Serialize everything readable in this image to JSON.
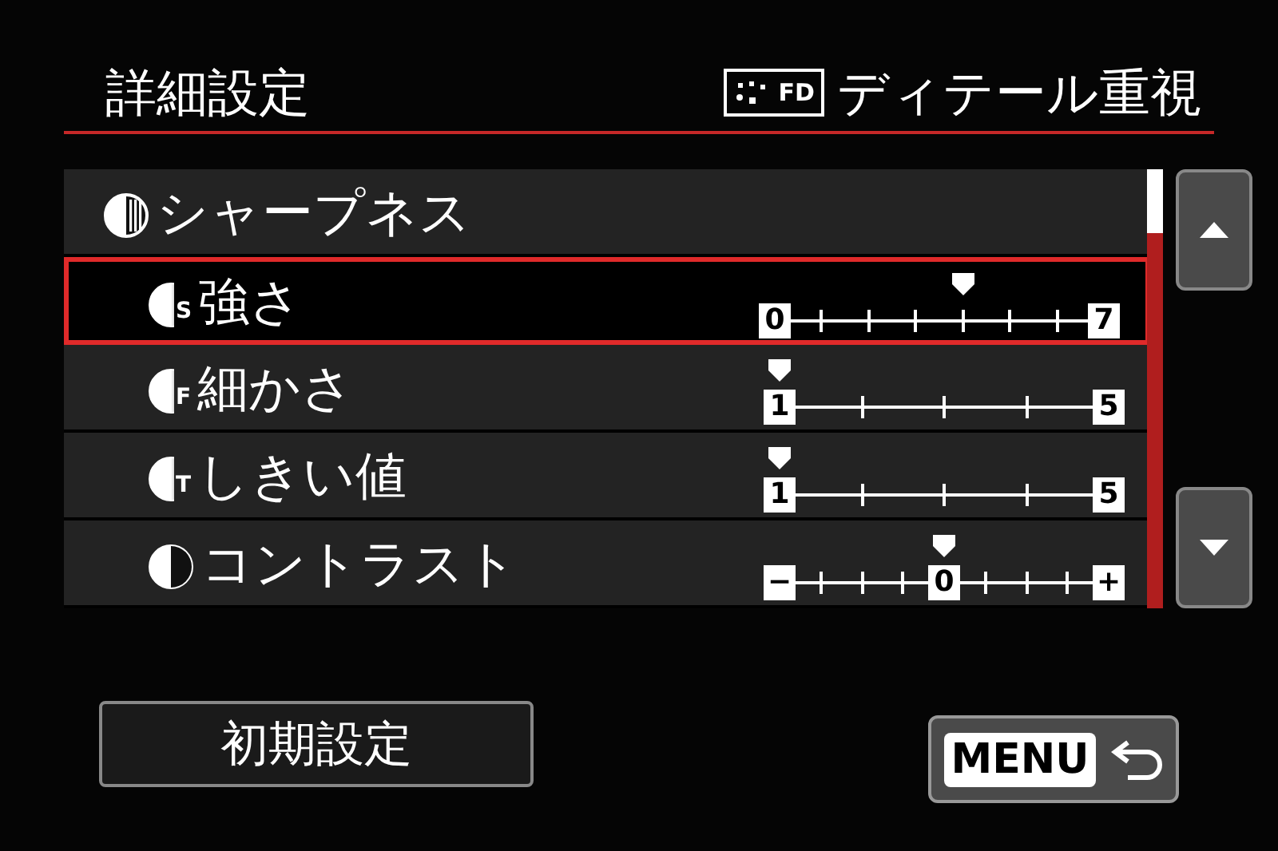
{
  "header": {
    "title": "詳細設定",
    "style_badge": "FD",
    "style_name": "ディテール重視"
  },
  "rows": [
    {
      "kind": "header",
      "label": "シャープネス",
      "selected": false
    },
    {
      "kind": "slider8",
      "icon_letter": "S",
      "label": "強さ",
      "selected": true,
      "min": "0",
      "max": "7",
      "level": 0.5714
    },
    {
      "kind": "slider5",
      "icon_letter": "F",
      "label": "細かさ",
      "selected": false,
      "min": "1",
      "max": "5",
      "level": 0
    },
    {
      "kind": "slider5",
      "icon_letter": "T",
      "label": "しきい値",
      "selected": false,
      "min": "1",
      "max": "5",
      "level": 0
    },
    {
      "kind": "slider9",
      "label": "コントラスト",
      "selected": false,
      "min": "−",
      "center": "0",
      "max": "+",
      "level": 0.5
    }
  ],
  "reset_button": "初期設定",
  "menu_button": "MENU"
}
